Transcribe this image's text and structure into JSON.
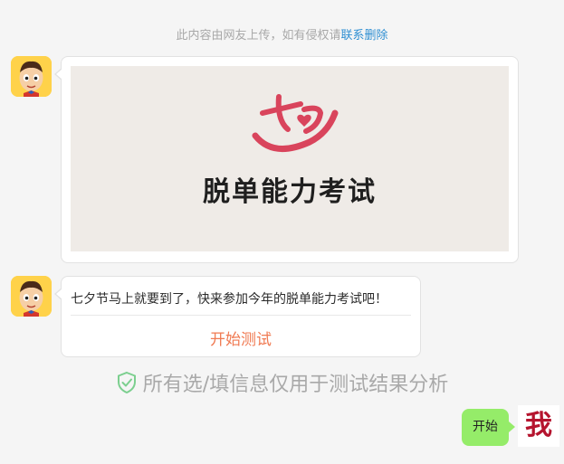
{
  "notice": {
    "text": "此内容由网友上传，如有侵权请",
    "link": "联系删除"
  },
  "banner": {
    "logo_glyph": "七夕",
    "title": "脱单能力考试"
  },
  "message": {
    "text": "七夕节马上就要到了，快来参加今年的脱单能力考试吧！",
    "action_label": "开始测试"
  },
  "privacy": {
    "text": "所有选/填信息仅用于测试结果分析"
  },
  "user": {
    "reply": "开始",
    "avatar_text": "我"
  },
  "colors": {
    "accent": "#f07a52",
    "link": "#2f8fd2",
    "user_bubble": "#95ec69",
    "logo": "#d9445c",
    "shield": "#7ccf8f"
  }
}
